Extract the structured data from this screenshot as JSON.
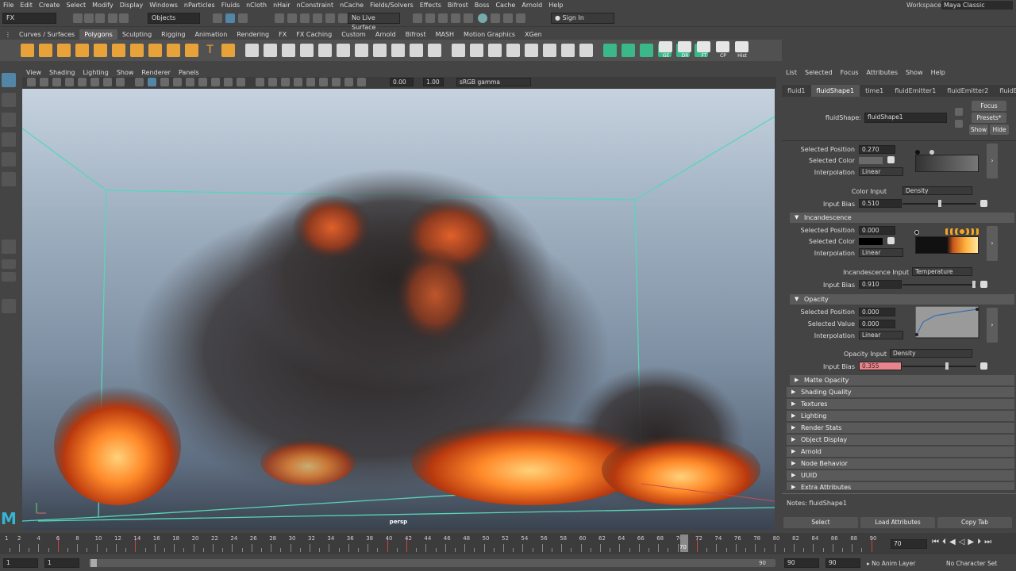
{
  "menubar": {
    "items": [
      "File",
      "Edit",
      "Create",
      "Select",
      "Modify",
      "Display",
      "Windows",
      "nParticles",
      "Fluids",
      "nCloth",
      "nHair",
      "nConstraint",
      "nCache",
      "Fields/Solvers",
      "Effects",
      "Bifrost",
      "Boss",
      "Cache",
      "Arnold",
      "Help"
    ],
    "workspace_label": "Workspace :",
    "workspace_value": "Maya Classic"
  },
  "statusline": {
    "menuset": "FX",
    "selmode": "Objects",
    "live_surface": "No Live Surface",
    "sign_in": "Sign In"
  },
  "shelf": {
    "tabs": [
      "Curves / Surfaces",
      "Polygons",
      "Sculpting",
      "Rigging",
      "Animation",
      "Rendering",
      "FX",
      "FX Caching",
      "Custom",
      "Arnold",
      "Bifrost",
      "MASH",
      "Motion Graphics",
      "XGen"
    ],
    "active_tab": "Polygons",
    "right_labels": [
      "GE",
      "DR",
      "FT",
      "CP",
      "Hist"
    ]
  },
  "viewport": {
    "menu": [
      "View",
      "Shading",
      "Lighting",
      "Show",
      "Renderer",
      "Panels"
    ],
    "exposure": "0.00",
    "gamma": "1.00",
    "colorspace": "sRGB gamma",
    "camera_label": "persp"
  },
  "ae": {
    "menu": [
      "List",
      "Selected",
      "Focus",
      "Attributes",
      "Show",
      "Help"
    ],
    "tabs": [
      "fluid1",
      "fluidShape1",
      "time1",
      "fluidEmitter1",
      "fluidEmitter2",
      "fluidEmi"
    ],
    "active_tab": "fluidShape1",
    "node_label": "fluidShape:",
    "node_value": "fluidShape1",
    "focus_btn": "Focus",
    "presets_btn": "Presets*",
    "show_btn": "Show",
    "hide_btn": "Hide",
    "color": {
      "sel_pos_label": "Selected Position",
      "sel_pos": "0.270",
      "sel_color_label": "Selected Color",
      "interp_label": "Interpolation",
      "interp": "Linear",
      "input_label": "Color Input",
      "input": "Density",
      "bias_label": "Input Bias",
      "bias": "0.510",
      "bias_fraction": 0.5
    },
    "incandescence": {
      "title": "Incandescence",
      "sel_pos_label": "Selected Position",
      "sel_pos": "0.000",
      "sel_color_label": "Selected Color",
      "interp_label": "Interpolation",
      "interp": "Linear",
      "input_label": "Incandescence Input",
      "input": "Temperature",
      "bias_label": "Input Bias",
      "bias": "0.910",
      "bias_fraction": 0.97
    },
    "opacity": {
      "title": "Opacity",
      "sel_pos_label": "Selected Position",
      "sel_pos": "0.000",
      "sel_val_label": "Selected Value",
      "sel_val": "0.000",
      "interp_label": "Interpolation",
      "interp": "Linear",
      "input_label": "Opacity Input",
      "input": "Density",
      "bias_label": "Input Bias",
      "bias": "0.355",
      "bias_fraction": 0.6
    },
    "sections": [
      "Matte Opacity",
      "Shading Quality",
      "Textures",
      "Lighting",
      "Render Stats",
      "Object Display",
      "Arnold",
      "Node Behavior",
      "UUID",
      "Extra Attributes"
    ],
    "notes_label": "Notes:",
    "notes_value": "fluidShape1",
    "bottom_buttons": [
      "Select",
      "Load Attributes",
      "Copy Tab"
    ],
    "accent_color": "#e8848e"
  },
  "timeline": {
    "ticks": [
      "2",
      "4",
      "6",
      "8",
      "10",
      "12",
      "14",
      "16",
      "18",
      "20",
      "22",
      "24",
      "26",
      "28",
      "30",
      "32",
      "34",
      "36",
      "38",
      "40",
      "42",
      "44",
      "46",
      "48",
      "50",
      "52",
      "54",
      "56",
      "58",
      "60",
      "62",
      "64",
      "66",
      "68",
      "70",
      "72",
      "74",
      "76",
      "78",
      "80",
      "82",
      "84",
      "86",
      "88",
      "90"
    ],
    "start_label": "1",
    "current_frame": "70",
    "current_frame_field": "70"
  },
  "range": {
    "start": "1",
    "inner_start": "1",
    "inner_end": "90",
    "end_a": "90",
    "end_b": "90",
    "anim_layer": "No Anim Layer",
    "char_set": "No Character Set"
  }
}
